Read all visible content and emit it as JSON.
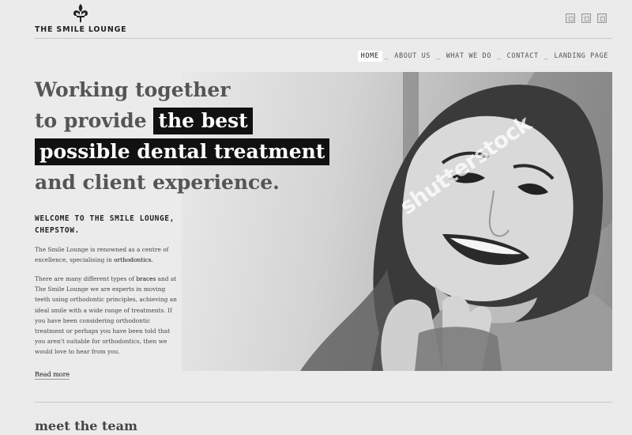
{
  "header": {
    "brand": "THE SMILE LOUNGE",
    "social_icons": [
      "social-icon-1",
      "social-icon-2",
      "social-icon-3"
    ]
  },
  "nav": {
    "items": [
      {
        "label": "HOME",
        "active": true
      },
      {
        "label": "ABOUT US",
        "active": false
      },
      {
        "label": "WHAT WE DO",
        "active": false
      },
      {
        "label": "CONTACT",
        "active": false
      },
      {
        "label": "LANDING PAGE",
        "active": false
      }
    ],
    "separator": "_"
  },
  "hero": {
    "headline": {
      "line1": "Working together",
      "line2_pre": "to provide",
      "line2_highlight": "the best",
      "line3_highlight": "possible dental treatment",
      "line4": "and client experience."
    },
    "watermark": "shutterstock"
  },
  "intro": {
    "welcome": "WELCOME TO THE SMILE LOUNGE, CHEPSTOW.",
    "p1_pre": "The Smile Lounge is renowned as a centre of excellence, specialising in ",
    "p1_link": "orthodontics",
    "p1_post": ".",
    "p2_pre": "There are many different types of ",
    "p2_link": "braces",
    "p2_post": " and at The Smile Lounge we are experts in moving teeth using orthodontic principles, achieving an ideal smile with a wide range of treatments. If you have been considering orthodontic treatment or perhaps you have been told that you aren't suitable for orthodontics, then we would love to hear from you.",
    "read_more": "Read more"
  },
  "team": {
    "heading": "meet the team"
  },
  "colors": {
    "background": "#ebebeb",
    "highlight_bg": "#111111",
    "highlight_text": "#ffffff"
  }
}
